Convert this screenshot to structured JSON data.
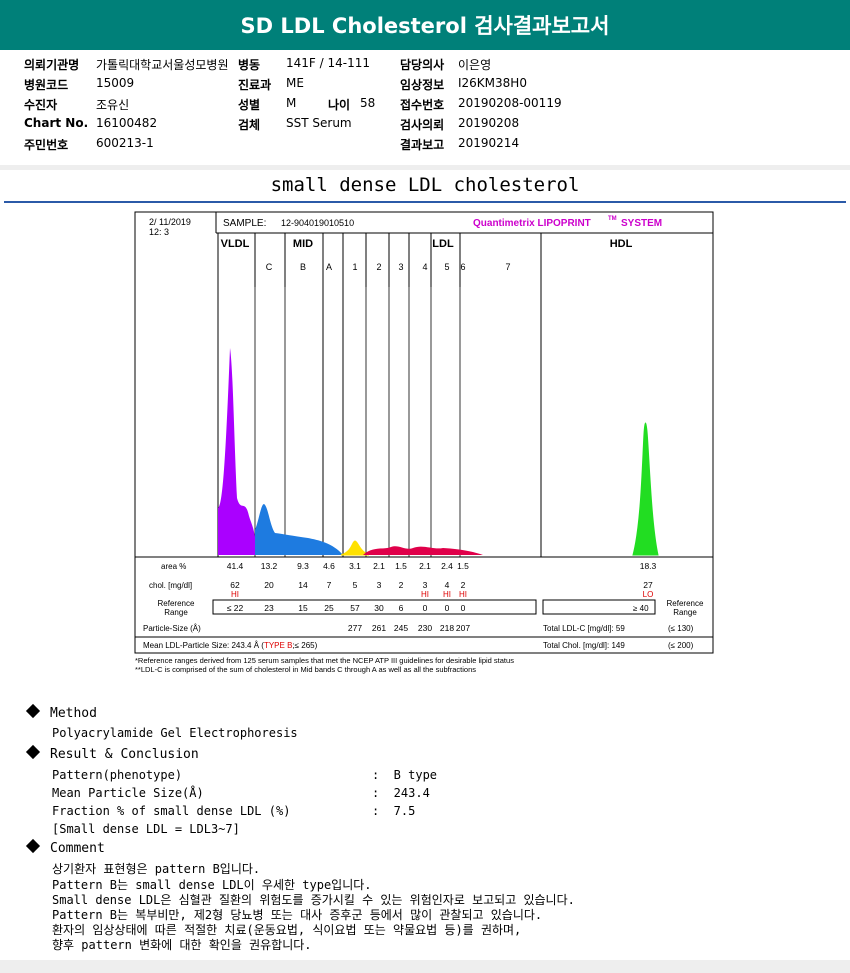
{
  "header": {
    "title": "SD LDL Cholesterol 검사결과보고서"
  },
  "info": {
    "hospital_label": "의뢰기관명",
    "hospital_value": "가톨릭대학교서울성모병원",
    "ward_label": "병동",
    "ward_value": "141F / 14-111",
    "doctor_label": "담당의사",
    "doctor_value": "이은영",
    "code_label": "병원코드",
    "code_value": "15009",
    "dept_label": "진료과",
    "dept_value": "ME",
    "clinical_label": "임상정보",
    "clinical_value": "I26KM38H0",
    "patient_label": "수진자",
    "patient_value": "조유신",
    "sex_label": "성별",
    "sex_value": "M",
    "age_label": "나이",
    "age_value": "58",
    "receipt_label": "접수번호",
    "receipt_value": "20190208-00119",
    "chart_label": "Chart No.",
    "chart_value": "16100482",
    "specimen_label": "검체",
    "specimen_value": "SST Serum",
    "request_label": "검사의뢰",
    "request_value": "20190208",
    "idnum_label": "주민번호",
    "idnum_value": "600213-1",
    "report_label": "결과보고",
    "report_value": "20190214"
  },
  "section_title": "small dense LDL cholesterol",
  "chart_data": {
    "type": "area",
    "date": "2/ 11/2019",
    "time": "12: 3",
    "sample_label": "SAMPLE:",
    "sample_value": "12-904019010510",
    "brand": "Quantimetrix LIPOPRINT",
    "brand_tm": "TM",
    "brand_suffix": "SYSTEM",
    "groups": [
      "VLDL",
      "MID",
      "LDL",
      "HDL"
    ],
    "bands": [
      "C",
      "B",
      "A",
      "1",
      "2",
      "3",
      "4",
      "5",
      "6",
      "7"
    ],
    "area_label": "area %",
    "area": [
      "41.4",
      "13.2",
      "9.3",
      "4.6",
      "3.1",
      "2.1",
      "1.5",
      "2.1",
      "2.4",
      "1.5",
      "18.3"
    ],
    "chol_label": "chol. [mg/dl]",
    "chol": [
      "62",
      "20",
      "14",
      "7",
      "5",
      "3",
      "2",
      "3",
      "4",
      "2",
      "27"
    ],
    "flags": [
      "HI",
      "",
      "",
      "",
      "",
      "",
      "",
      "HI",
      "HI",
      "HI",
      "LO"
    ],
    "ref_label_1": "Reference",
    "ref_label_2": "Range",
    "ref": [
      "≤ 22",
      "23",
      "15",
      "25",
      "57",
      "30",
      "6",
      "0",
      "0",
      "0"
    ],
    "ref_hdl": "≥ 40",
    "ref_right_1": "Reference",
    "ref_right_2": "Range",
    "ps_label": "Particle-Size (Å)",
    "particle_size": [
      "277",
      "261",
      "245",
      "230",
      "218",
      "207"
    ],
    "total_ldl_label": "Total LDL-C [mg/dl]: 59",
    "total_ldl_range": "(≤ 130)",
    "mean_label": "Mean LDL-Particle Size:  243.4 Å  (",
    "mean_type": "TYPE B",
    "mean_tail": ";≤ 265)",
    "total_chol_label": "Total Chol. [mg/dl]:   149",
    "total_chol_range": "(≤ 200)",
    "footnote_1": "*Reference ranges derived from 125 serum samples that met the NCEP ATP III guidelines for desirable lipid status",
    "footnote_2": "**LDL-C is comprised of the sum of cholesterol in Mid bands C through A as well as all the subfractions"
  },
  "method": {
    "heading": "Method",
    "text": "Polyacrylamide Gel Electrophoresis"
  },
  "result": {
    "heading": "Result & Conclusion",
    "pattern_label": "Pattern(phenotype)",
    "pattern_value": ":  B type",
    "size_label": "Mean Particle Size(Å)",
    "size_value": ":  243.4",
    "fraction_label": "Fraction % of small dense LDL (%)",
    "fraction_value": ":  7.5",
    "note": "[Small dense LDL = LDL3~7]"
  },
  "comment": {
    "heading": "Comment",
    "lines": [
      "상기환자 표현형은 pattern B입니다.",
      "Pattern B는 small dense LDL이 우세한 type입니다.",
      "Small dense LDL은 심혈관 질환의 위험도를 증가시킬 수 있는 위험인자로 보고되고 있습니다.",
      "Pattern B는 복부비만, 제2형 당뇨병 또는 대사 증후군 등에서 많이 관찰되고 있습니다.",
      "환자의 임상상태에 따른 적절한 치료(운동요법, 식이요법 또는 약물요법 등)를 권하며,",
      "향후 pattern 변화에 대한 확인을 권유합니다."
    ]
  },
  "colors": {
    "header_bg": "#008079",
    "vldl": "#aa00ff",
    "mid": "#1e7be0",
    "ldl1": "#ffe100",
    "ldl_hi": "#e0004a",
    "hdl": "#22dd22",
    "flag": "#dd0000",
    "brand": "#cc00cc",
    "rule": "#2b5aa8"
  }
}
